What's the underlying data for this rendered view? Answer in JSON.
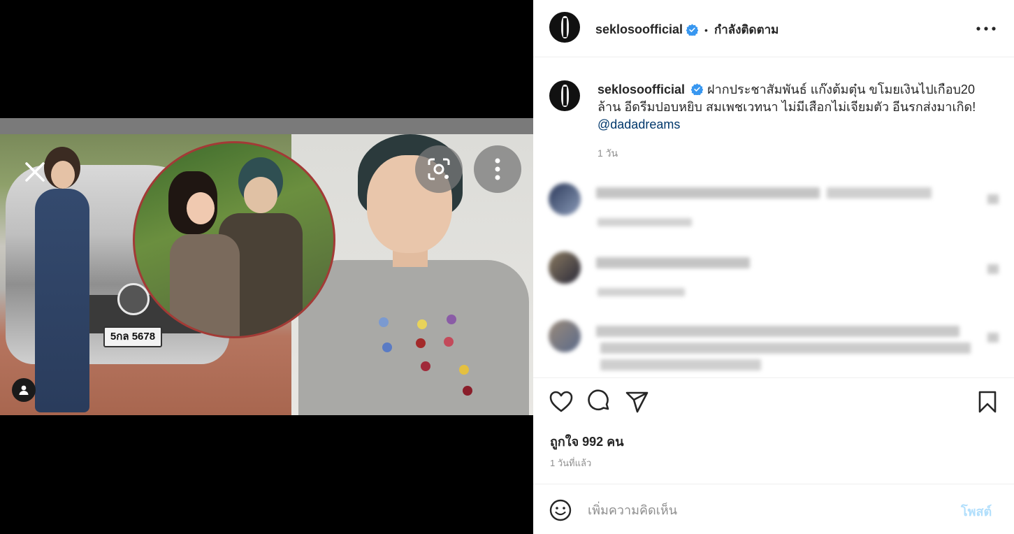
{
  "post": {
    "plate_text": "5กล 5678"
  },
  "header": {
    "username": "seklosoofficial",
    "separator": "•",
    "follow_label": "กำลังติดตาม"
  },
  "caption": {
    "username": "seklosoofficial",
    "text": "ฝากประชาสัมพันธ์ แก๊งต้มตุ๋น ขโมยเงินไปเกือบ20 ล้าน อีดรีมปอบหยิบ สมเพชเวทนา ไม่มีเสือกไม่เจียมตัว อีนรกส่งมาเกิด!",
    "mention": "@dadadreams",
    "time": "1 วัน"
  },
  "engagement": {
    "likes": "ถูกใจ 992 คน",
    "posted": "1 วันที่แล้ว"
  },
  "comment_box": {
    "placeholder": "เพิ่มความคิดเห็น",
    "post_label": "โพสต์"
  },
  "colors": {
    "link": "#00376b",
    "verified": "#3897f0",
    "post_disabled": "#b2dffc"
  }
}
